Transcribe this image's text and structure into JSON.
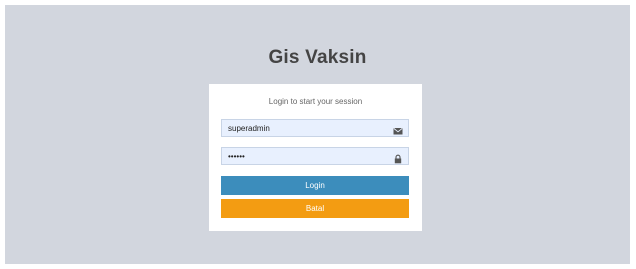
{
  "app": {
    "title": "Gis Vaksin"
  },
  "login_box": {
    "message": "Login to start your session",
    "username": {
      "value": "superadmin",
      "icon": "envelope-icon"
    },
    "password": {
      "value": "••••••",
      "icon": "lock-icon"
    },
    "login_label": "Login",
    "cancel_label": "Batal"
  },
  "colors": {
    "background": "#d2d6de",
    "login_button": "#3c8dbc",
    "cancel_button": "#f39c12",
    "input_autofill": "#e8f0fe"
  }
}
